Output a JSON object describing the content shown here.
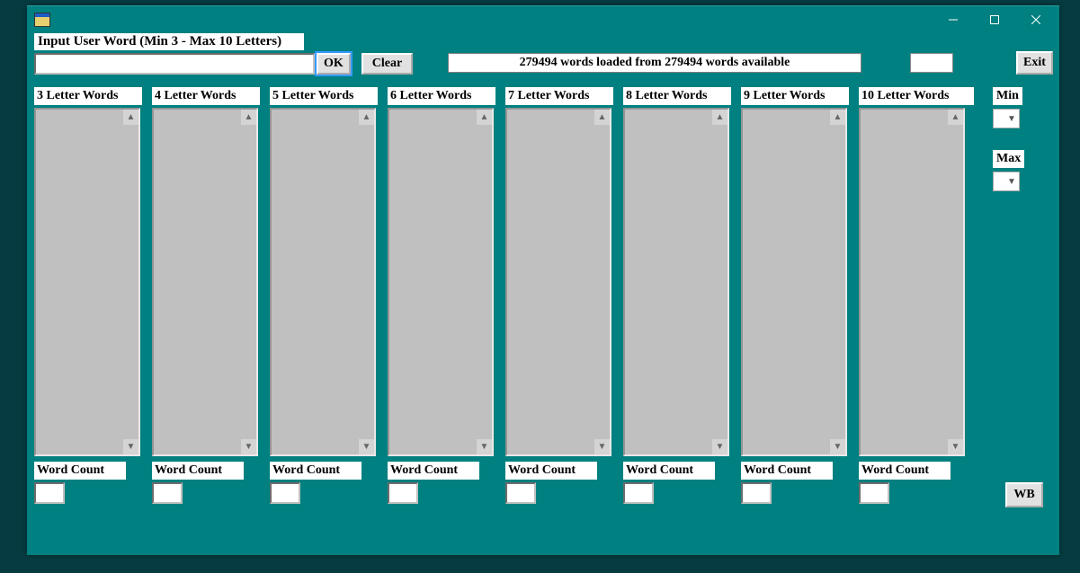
{
  "window": {
    "title": ""
  },
  "labels": {
    "input_prompt": "Input User Word (Min 3 - Max 10 Letters)",
    "word_count": "Word Count",
    "min": "Min",
    "max": "Max"
  },
  "buttons": {
    "ok": "OK",
    "clear": "Clear",
    "exit": "Exit",
    "wb": "WB"
  },
  "status": "279494 words loaded from 279494  words available",
  "input": {
    "value": ""
  },
  "extra_box": {
    "value": ""
  },
  "min_select": {
    "value": ""
  },
  "max_select": {
    "value": ""
  },
  "columns": [
    {
      "header": "3 Letter Words",
      "items": [],
      "count": ""
    },
    {
      "header": "4 Letter Words",
      "items": [],
      "count": ""
    },
    {
      "header": "5 Letter Words",
      "items": [],
      "count": ""
    },
    {
      "header": "6 Letter Words",
      "items": [],
      "count": ""
    },
    {
      "header": "7 Letter Words",
      "items": [],
      "count": ""
    },
    {
      "header": "8 Letter Words",
      "items": [],
      "count": ""
    },
    {
      "header": "9 Letter Words",
      "items": [],
      "count": ""
    },
    {
      "header": "10 Letter Words",
      "items": [],
      "count": ""
    }
  ],
  "icons": {
    "app": "app-icon",
    "minimize": "minimize-icon",
    "maximize": "maximize-icon",
    "close": "close-icon",
    "chevron": "chevron-down-icon",
    "scroll_up": "scroll-up-icon",
    "scroll_down": "scroll-down-icon"
  }
}
